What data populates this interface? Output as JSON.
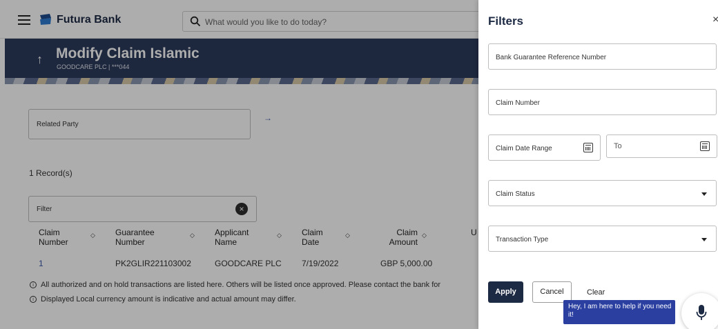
{
  "header": {
    "brand": "Futura Bank",
    "search_placeholder": "What would you like to do today?"
  },
  "banner": {
    "title": "Modify Claim Islamic",
    "subtitle": "GOODCARE PLC | ***044"
  },
  "main": {
    "related_party_label": "Related Party",
    "records": "1 Record(s)",
    "filter_label": "Filter",
    "columns": [
      {
        "line1": "Claim",
        "line2": "Number"
      },
      {
        "line1": "Guarantee",
        "line2": "Number"
      },
      {
        "line1": "Applicant",
        "line2": "Name"
      },
      {
        "line1": "Claim",
        "line2": "Date"
      },
      {
        "line1": "Claim",
        "line2": "Amount"
      },
      {
        "line1": "U",
        "line2": ""
      }
    ],
    "rows": [
      {
        "claim_number": "1",
        "guarantee_number": "PK2GLIR221103002",
        "applicant_name": "GOODCARE PLC",
        "claim_date": "7/19/2022",
        "claim_amount": "GBP 5,000.00"
      }
    ],
    "notes": [
      "All authorized and on hold transactions are listed here. Others will be listed once approved. Please contact the bank for",
      "Displayed Local currency amount is indicative and actual amount may differ."
    ]
  },
  "filters": {
    "title": "Filters",
    "close": "×",
    "bank_guarantee_ref": "Bank Guarantee Reference Number",
    "claim_number": "Claim Number",
    "claim_date_range": "Claim Date Range",
    "to": "To",
    "claim_status": "Claim Status",
    "transaction_type": "Transaction Type",
    "apply": "Apply",
    "cancel": "Cancel",
    "clear": "Clear"
  },
  "assistant": {
    "message": "Hey, I am here to help if you need it!"
  },
  "icons": [
    "menu-icon",
    "bank-logo-icon",
    "search-icon",
    "back-arrow-icon",
    "arrow-right-icon",
    "clear-circle-icon",
    "sort-icon",
    "info-icon",
    "calendar-icon",
    "chevron-down-icon",
    "close-icon",
    "microphone-icon"
  ],
  "colors": {
    "primary": "#1d2a44",
    "banner": "#2b3a5c",
    "link": "#3a56a8",
    "assistant": "#2a3fa0"
  }
}
